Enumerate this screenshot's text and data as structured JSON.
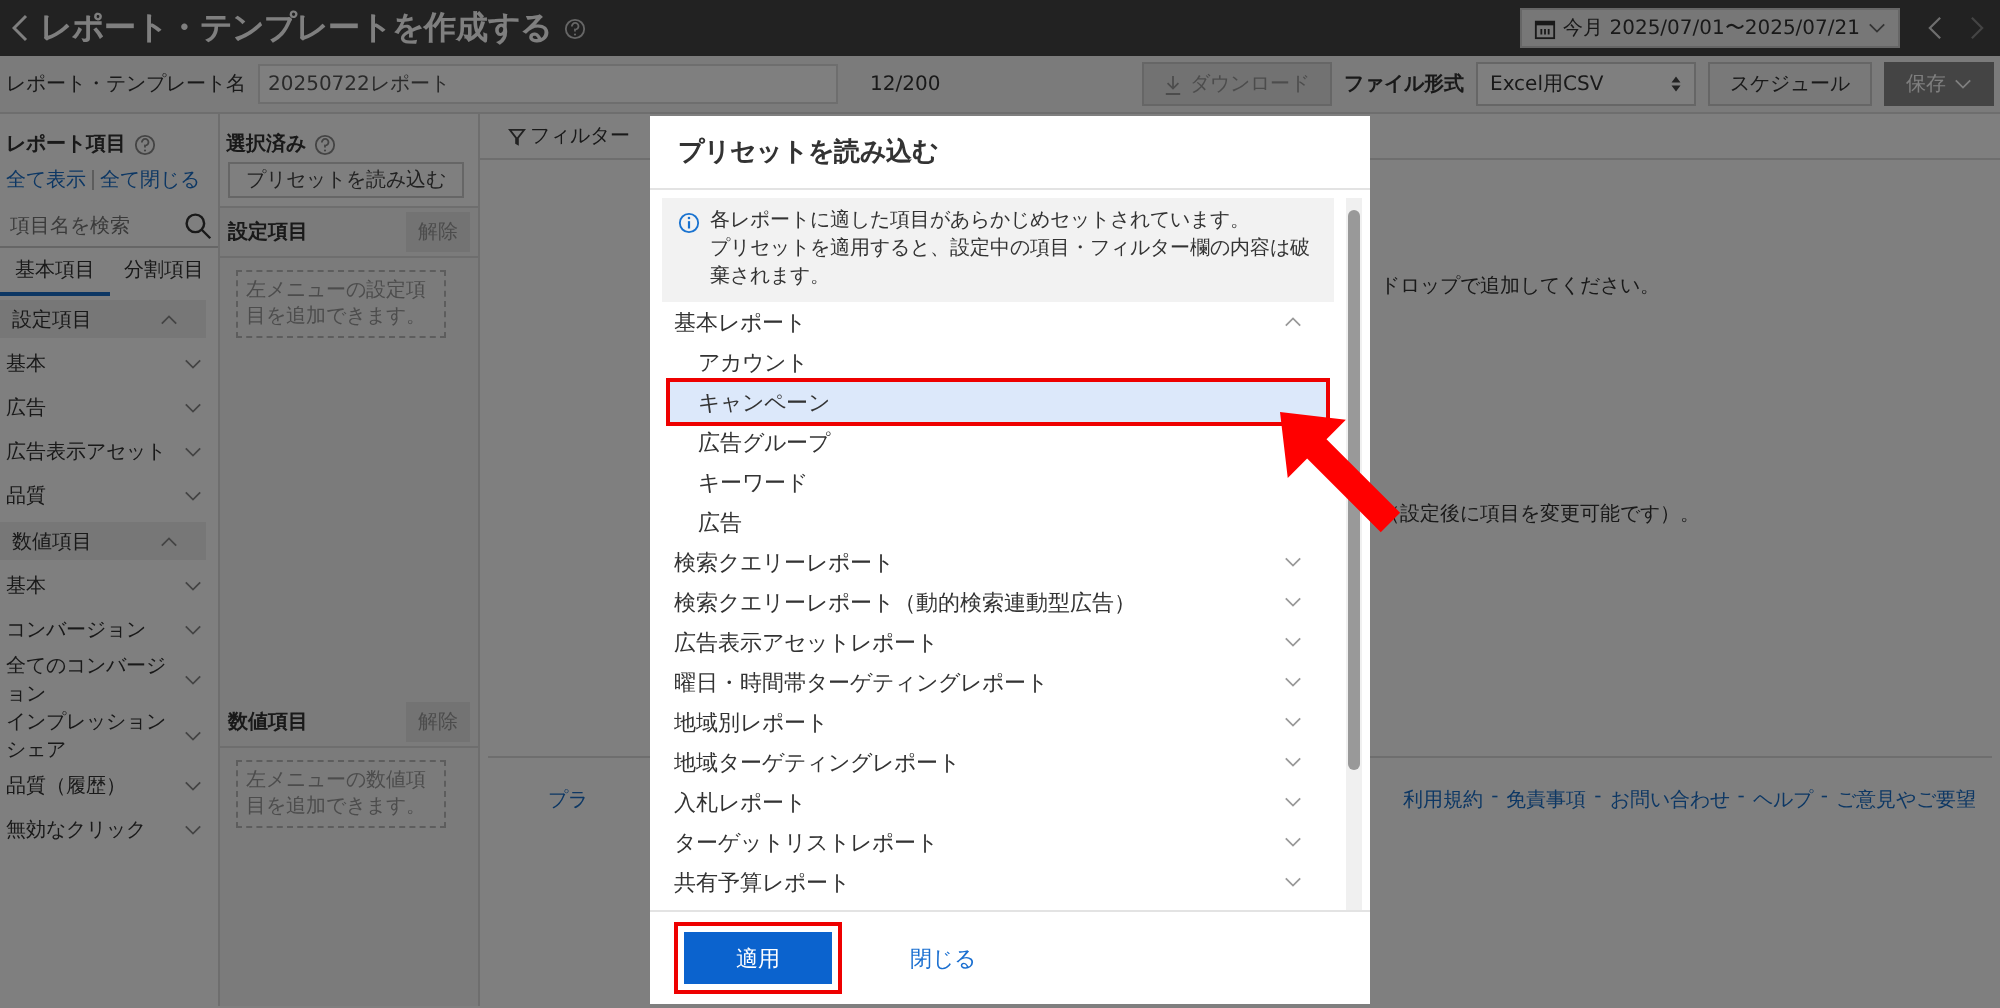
{
  "header": {
    "title": "レポート・テンプレートを作成する",
    "date_range": "今月 2025/07/01〜2025/07/21"
  },
  "name_bar": {
    "label": "レポート・テンプレート名",
    "value": "20250722レポート",
    "counter": "12/200",
    "download": "ダウンロード",
    "file_format_label": "ファイル形式",
    "file_format": "Excel用CSV",
    "schedule": "スケジュール",
    "save": "保存"
  },
  "report_items": {
    "title": "レポート項目",
    "show_all": "全て表示",
    "collapse_all": "全て閉じる",
    "search_placeholder": "項目名を検索",
    "tabs": [
      {
        "label": "基本項目",
        "selected": true
      },
      {
        "label": "分割項目",
        "selected": false
      }
    ],
    "groups": [
      {
        "label": "設定項目",
        "expanded": true,
        "children": [
          {
            "label": "基本",
            "expanded": false
          },
          {
            "label": "広告",
            "expanded": false
          },
          {
            "label": "広告表示アセット",
            "expanded": false
          },
          {
            "label": "品質",
            "expanded": false
          }
        ]
      },
      {
        "label": "数値項目",
        "expanded": true,
        "children": [
          {
            "label": "基本",
            "expanded": false
          },
          {
            "label": "コンバージョン",
            "expanded": false
          },
          {
            "label": "全てのコンバージョン",
            "expanded": false
          },
          {
            "label": "インプレッションシェア",
            "expanded": false
          },
          {
            "label": "品質（履歴）",
            "expanded": false
          },
          {
            "label": "無効なクリック",
            "expanded": false
          }
        ]
      }
    ]
  },
  "selected": {
    "title": "選択済み",
    "preset_button": "プリセットを読み込む",
    "sections": [
      {
        "label": "設定項目",
        "clear": "解除",
        "hint": "左メニューの設定項目を追加できます。"
      },
      {
        "label": "数値項目",
        "clear": "解除",
        "hint": "左メニューの数値項目を追加できます。"
      }
    ]
  },
  "canvas": {
    "filter": "フィルター",
    "texts": [
      "ドロップで追加してください。",
      "（設定後に項目を変更可能です）。"
    ],
    "footer_cut": "プラ",
    "footer_separator": "-",
    "footer_links": [
      "利用規約",
      "免責事項",
      "お問い合わせ",
      "ヘルプ",
      "ご意見やご要望"
    ]
  },
  "modal": {
    "title": "プリセットを読み込む",
    "info": [
      "各レポートに適した項目があらかじめセットされています。",
      "プリセットを適用すると、設定中の項目・フィルター欄の内容は破棄されます。"
    ],
    "groups": [
      {
        "label": "基本レポート",
        "expanded": true,
        "children": [
          {
            "label": "アカウント",
            "selected": false,
            "highlighted": false
          },
          {
            "label": "キャンペーン",
            "selected": true,
            "highlighted": true
          },
          {
            "label": "広告グループ",
            "selected": false,
            "highlighted": false
          },
          {
            "label": "キーワード",
            "selected": false,
            "highlighted": false
          },
          {
            "label": "広告",
            "selected": false,
            "highlighted": false
          }
        ]
      },
      {
        "label": "検索クエリーレポート",
        "expanded": false
      },
      {
        "label": "検索クエリーレポート（動的検索連動型広告）",
        "expanded": false
      },
      {
        "label": "広告表示アセットレポート",
        "expanded": false
      },
      {
        "label": "曜日・時間帯ターゲティングレポート",
        "expanded": false
      },
      {
        "label": "地域別レポート",
        "expanded": false
      },
      {
        "label": "地域ターゲティングレポート",
        "expanded": false
      },
      {
        "label": "入札レポート",
        "expanded": false
      },
      {
        "label": "ターゲットリストレポート",
        "expanded": false
      },
      {
        "label": "共有予算レポート",
        "expanded": false
      }
    ],
    "apply": {
      "label": "適用",
      "highlighted": true
    },
    "close": "閉じる"
  }
}
